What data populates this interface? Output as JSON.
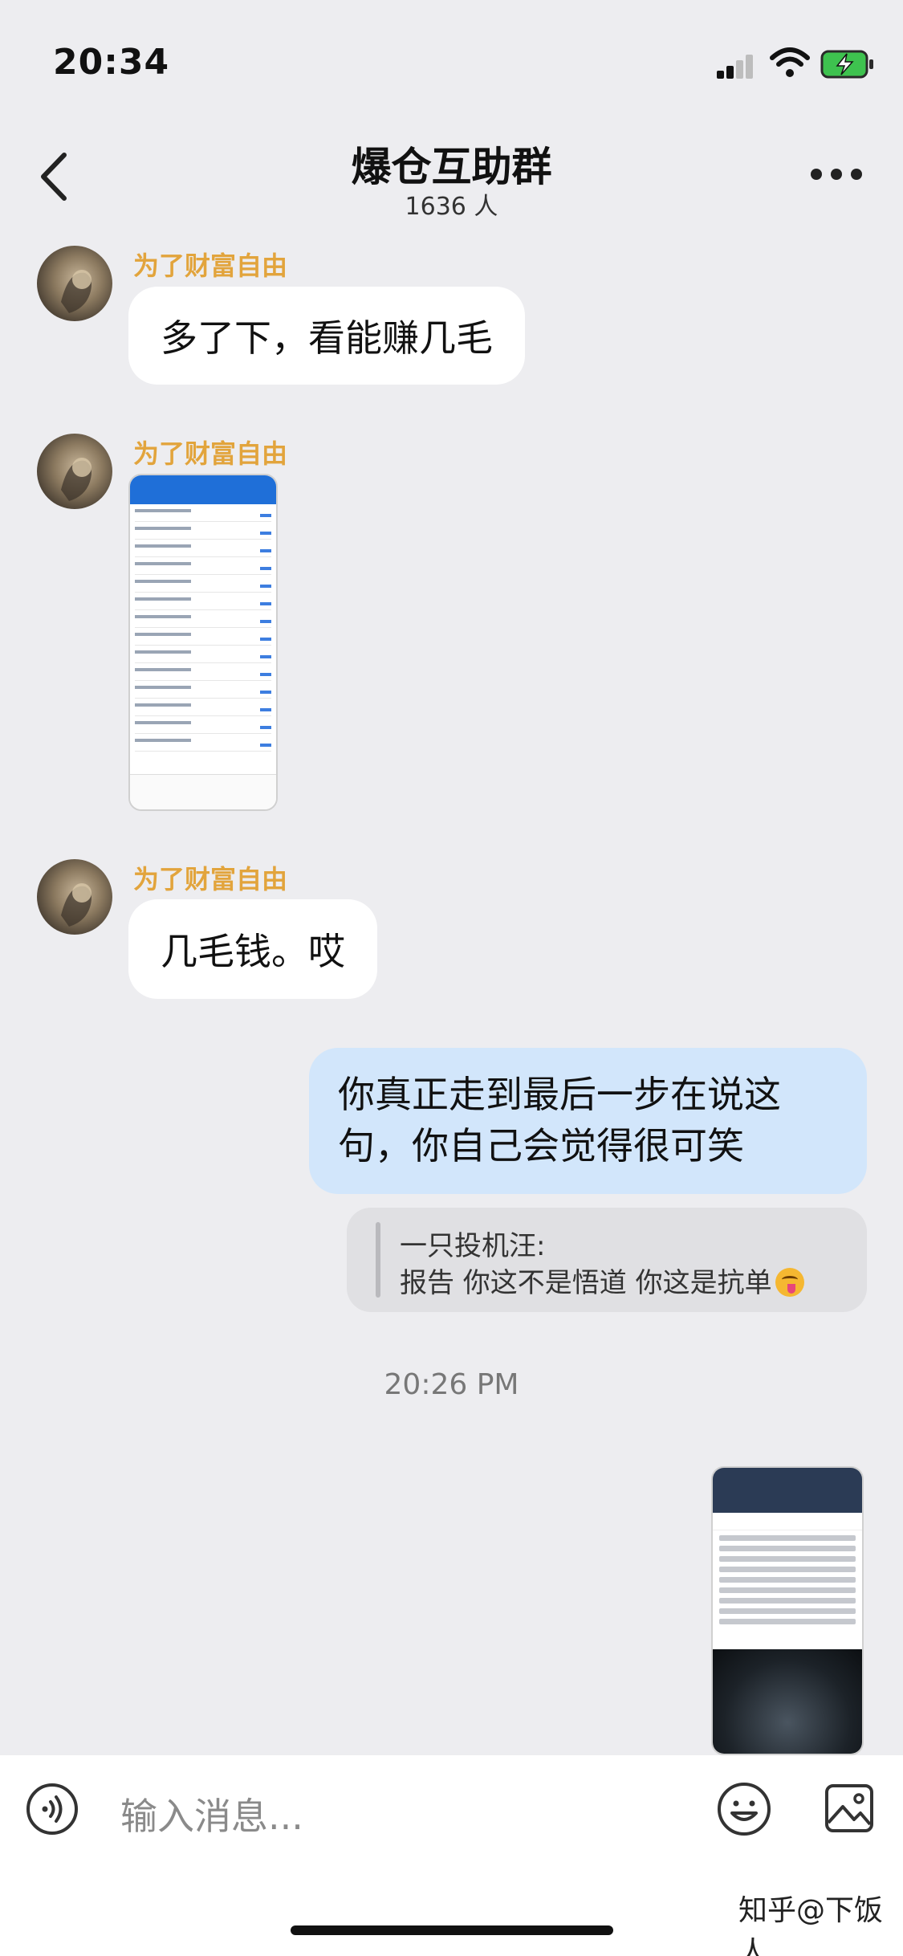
{
  "status_bar": {
    "time": "20:34"
  },
  "header": {
    "title": "爆仓互助群",
    "member_count": "1636 人"
  },
  "messages": [
    {
      "sender": "为了财富自由",
      "text": "多了下，看能赚几毛"
    },
    {
      "sender": "为了财富自由",
      "type": "image"
    },
    {
      "sender": "为了财富自由",
      "text": "几毛钱。哎"
    }
  ],
  "outgoing": {
    "line1": "你真正走到最后一步在说这",
    "line2": "句，你自己会觉得很可笑"
  },
  "quote": {
    "author": "一只投机汪:",
    "text": "报告 你这不是悟道 你这是抗单"
  },
  "timestamp": "20:26 PM",
  "input": {
    "placeholder": "输入消息..."
  },
  "watermark": "知乎@下饭人",
  "colors": {
    "sender_name": "#e2a43c",
    "outgoing_bubble": "#d2e6fb",
    "background": "#ededf0"
  }
}
